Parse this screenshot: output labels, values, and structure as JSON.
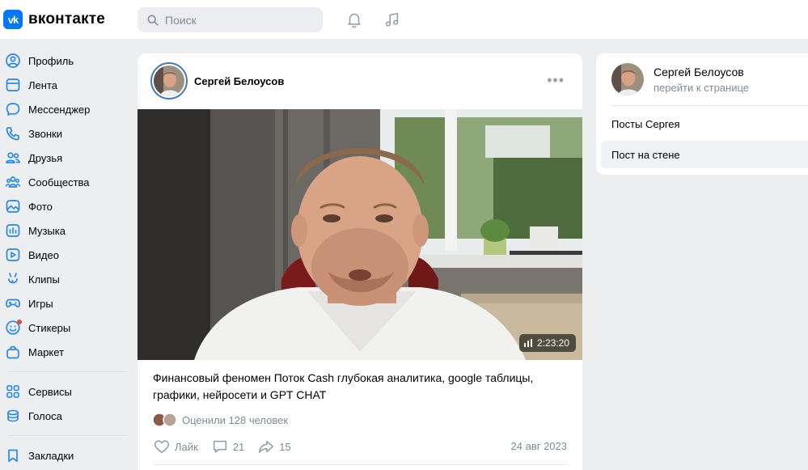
{
  "header": {
    "logo_mark": "vk",
    "logo_text": "вконтакте",
    "search_placeholder": "Поиск",
    "icons": [
      "bell-icon",
      "music-icon"
    ]
  },
  "sidebar": {
    "items": [
      {
        "label": "Профиль",
        "icon": "user-circle-icon"
      },
      {
        "label": "Лента",
        "icon": "feed-icon"
      },
      {
        "label": "Мессенджер",
        "icon": "message-icon"
      },
      {
        "label": "Звонки",
        "icon": "phone-icon"
      },
      {
        "label": "Друзья",
        "icon": "friends-icon"
      },
      {
        "label": "Сообщества",
        "icon": "communities-icon"
      },
      {
        "label": "Фото",
        "icon": "photo-icon"
      },
      {
        "label": "Музыка",
        "icon": "music-icon"
      },
      {
        "label": "Видео",
        "icon": "video-icon"
      },
      {
        "label": "Клипы",
        "icon": "clips-icon"
      },
      {
        "label": "Игры",
        "icon": "gamepad-icon"
      },
      {
        "label": "Стикеры",
        "icon": "smile-icon"
      },
      {
        "label": "Маркет",
        "icon": "bag-icon"
      }
    ],
    "group2": [
      {
        "label": "Сервисы",
        "icon": "grid-icon"
      },
      {
        "label": "Голоса",
        "icon": "coins-icon"
      }
    ],
    "group3": [
      {
        "label": "Закладки",
        "icon": "bookmark-icon"
      }
    ]
  },
  "post": {
    "author": "Сергей Белоусов",
    "video_duration": "2:23:20",
    "text": "Финансовый феномен Поток Cash глубокая аналитика, google таблицы, графики, нейросети и GPT CHAT",
    "likes_text": "Оценили 128 человек",
    "like_label": "Лайк",
    "comments_count": "21",
    "shares_count": "15",
    "date": "24 авг 2023"
  },
  "right_panel": {
    "name": "Сергей Белоусов",
    "subtitle": "перейти к странице",
    "items": [
      {
        "label": "Посты Сергея",
        "active": false
      },
      {
        "label": "Пост на стене",
        "active": true
      }
    ]
  },
  "colors": {
    "accent": "#0077ff",
    "background": "#edeef0",
    "secondary_text": "#818c99",
    "icon_blue": "#2688eb",
    "notification_dot": "#e64646"
  }
}
